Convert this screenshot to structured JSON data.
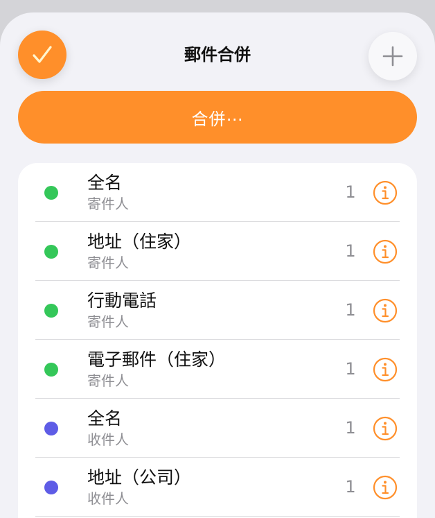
{
  "header": {
    "title": "郵件合併",
    "done_icon": "checkmark-icon",
    "add_icon": "plus-icon"
  },
  "merge_button": {
    "label": "合併⋯"
  },
  "colors": {
    "accent": "#FF8F2A",
    "sender": "#34C759",
    "recipient": "#5E5CE6"
  },
  "fields": [
    {
      "label": "全名",
      "source": "寄件人",
      "count": "1",
      "group": "sender"
    },
    {
      "label": "地址（住家）",
      "source": "寄件人",
      "count": "1",
      "group": "sender"
    },
    {
      "label": "行動電話",
      "source": "寄件人",
      "count": "1",
      "group": "sender"
    },
    {
      "label": "電子郵件（住家）",
      "source": "寄件人",
      "count": "1",
      "group": "sender"
    },
    {
      "label": "全名",
      "source": "收件人",
      "count": "1",
      "group": "recipient"
    },
    {
      "label": "地址（公司）",
      "source": "收件人",
      "count": "1",
      "group": "recipient"
    }
  ]
}
